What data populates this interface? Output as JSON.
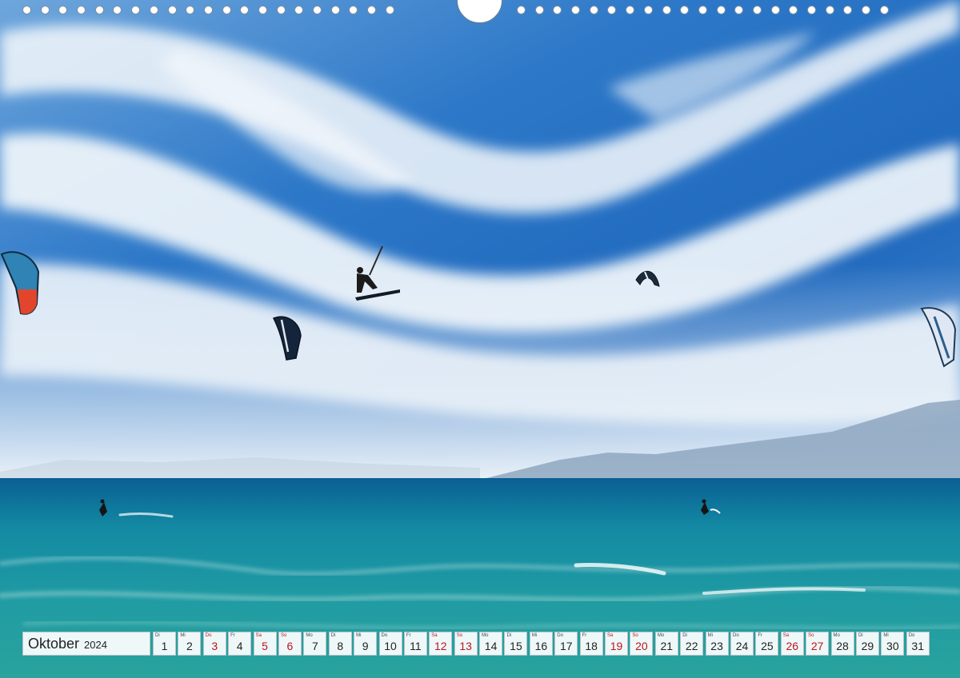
{
  "calendar": {
    "month": "Oktober",
    "year": "2024",
    "weekend_color": "#c0141e",
    "days": [
      {
        "wd": "Di",
        "d": "1"
      },
      {
        "wd": "Mi",
        "d": "2"
      },
      {
        "wd": "Do",
        "d": "3",
        "weekend": true
      },
      {
        "wd": "Fr",
        "d": "4"
      },
      {
        "wd": "Sa",
        "d": "5",
        "weekend": true
      },
      {
        "wd": "So",
        "d": "6",
        "weekend": true
      },
      {
        "wd": "Mo",
        "d": "7"
      },
      {
        "wd": "Di",
        "d": "8"
      },
      {
        "wd": "Mi",
        "d": "9"
      },
      {
        "wd": "Do",
        "d": "10"
      },
      {
        "wd": "Fr",
        "d": "11"
      },
      {
        "wd": "Sa",
        "d": "12",
        "weekend": true
      },
      {
        "wd": "So",
        "d": "13",
        "weekend": true
      },
      {
        "wd": "Mo",
        "d": "14"
      },
      {
        "wd": "Di",
        "d": "15"
      },
      {
        "wd": "Mi",
        "d": "16"
      },
      {
        "wd": "Do",
        "d": "17"
      },
      {
        "wd": "Fr",
        "d": "18"
      },
      {
        "wd": "Sa",
        "d": "19",
        "weekend": true
      },
      {
        "wd": "So",
        "d": "20",
        "weekend": true
      },
      {
        "wd": "Mo",
        "d": "21"
      },
      {
        "wd": "Di",
        "d": "22"
      },
      {
        "wd": "Mi",
        "d": "23"
      },
      {
        "wd": "Do",
        "d": "24"
      },
      {
        "wd": "Fr",
        "d": "25"
      },
      {
        "wd": "Sa",
        "d": "26",
        "weekend": true
      },
      {
        "wd": "So",
        "d": "27",
        "weekend": true
      },
      {
        "wd": "Mo",
        "d": "28"
      },
      {
        "wd": "Di",
        "d": "29"
      },
      {
        "wd": "Mi",
        "d": "30"
      },
      {
        "wd": "Do",
        "d": "31"
      }
    ]
  },
  "photo": {
    "subject": "kitesurfers over sea",
    "sky_colors": [
      "#1f6fc4",
      "#5c9ee0",
      "#eef4fb"
    ],
    "sea_colors": [
      "#0a6e9a",
      "#1a9aa6",
      "#3fb6a9"
    ]
  }
}
